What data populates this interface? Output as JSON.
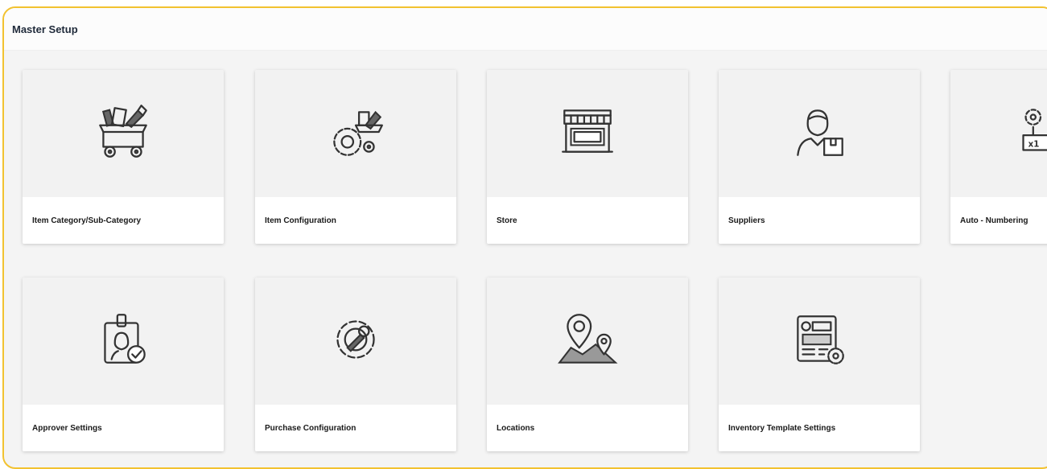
{
  "header": {
    "title": "Master Setup"
  },
  "cards": [
    {
      "label": "Item Category/Sub-Category",
      "icon": "shopping-cart-icon"
    },
    {
      "label": "Item Configuration",
      "icon": "gear-cart-icon"
    },
    {
      "label": "Store",
      "icon": "storefront-icon"
    },
    {
      "label": "Suppliers",
      "icon": "supplier-person-icon"
    },
    {
      "label": "Auto - Numbering",
      "icon": "auto-numbering-icon",
      "icon_text": "x1"
    },
    {
      "label": "Approver Settings",
      "icon": "id-badge-check-icon"
    },
    {
      "label": "Purchase Configuration",
      "icon": "gear-wrench-icon"
    },
    {
      "label": "Locations",
      "icon": "map-pin-icon"
    },
    {
      "label": "Inventory Template Settings",
      "icon": "template-gear-icon"
    }
  ],
  "colors": {
    "frame_border": "#f2c230",
    "card_bg": "#f2f2f2",
    "label_bg": "#ffffff"
  }
}
